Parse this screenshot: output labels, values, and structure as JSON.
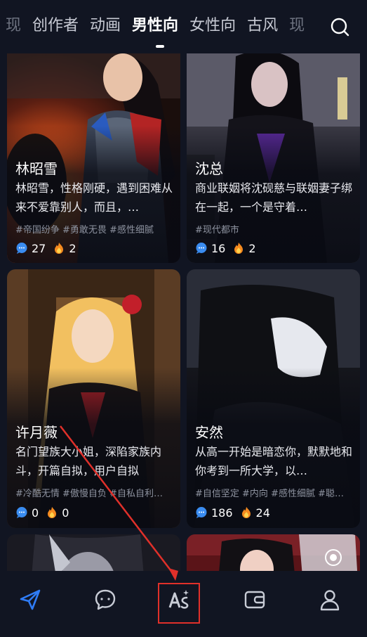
{
  "tabs": [
    "现",
    "创作者",
    "动画",
    "男性向",
    "女性向",
    "古风",
    "现"
  ],
  "active_tab": "男性向",
  "icons": {
    "search": "search-icon",
    "comment": "chat-bubble-icon",
    "hot": "fire-icon",
    "nav": [
      "send-icon",
      "chat-icon",
      "ai-create-icon",
      "wallet-icon",
      "profile-icon"
    ]
  },
  "cards": [
    {
      "name": "林昭雪",
      "desc": "林昭雪，性格刚硬，遇到困难从来不爱靠别人，而且，…",
      "tags": "#帝国纷争 #勇敢无畏 #感性细腻",
      "comments": "27",
      "hot": "2"
    },
    {
      "name": "沈总",
      "desc": "商业联姻将沈砚慈与联姻妻子绑在一起，一个是守着…",
      "tags": "#现代都市",
      "comments": "16",
      "hot": "2"
    },
    {
      "name": "许月薇",
      "desc": "名门望族大小姐，深陷家族内斗，开篇自拟，用户自拟",
      "tags": "#冷酷无情 #傲慢自负 #自私自利…",
      "comments": "0",
      "hot": "0"
    },
    {
      "name": "安然",
      "desc": "从高一开始是暗恋你，默默地和你考到一所大学，以…",
      "tags": "#自信坚定 #内向 #感性细腻 #聪…",
      "comments": "186",
      "hot": "24"
    }
  ],
  "colors": {
    "background": "#111522",
    "highlight": "#e0302a",
    "accent": "#2f7cf6"
  }
}
